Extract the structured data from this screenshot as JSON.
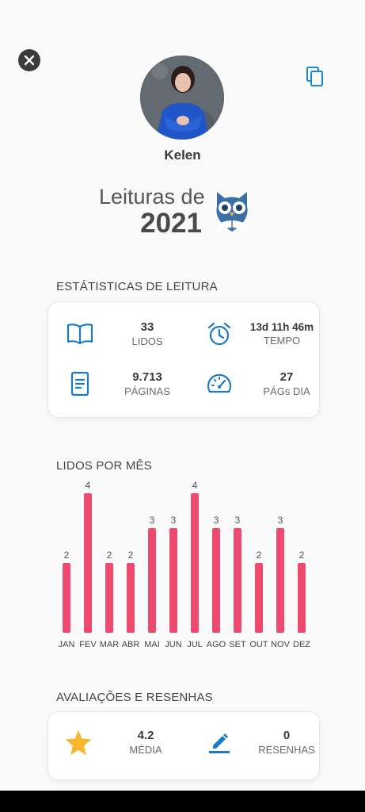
{
  "profile": {
    "name": "Kelen"
  },
  "header": {
    "title": "Leituras de",
    "year": "2021"
  },
  "reading_stats": {
    "title": "ESTÁTISTICAS DE LEITURA",
    "read": {
      "value": "33",
      "label": "LIDOS"
    },
    "time": {
      "value": "13d 11h 46m",
      "label": "TEMPO"
    },
    "pages": {
      "value": "9.713",
      "label": "PÁGINAS"
    },
    "pages_per_day": {
      "value": "27",
      "label": "PÁGs DIA"
    }
  },
  "monthly": {
    "title": "LIDOS POR MÊS"
  },
  "chart_data": {
    "type": "bar",
    "categories": [
      "JAN",
      "FEV",
      "MAR",
      "ABR",
      "MAI",
      "JUN",
      "JUL",
      "AGO",
      "SET",
      "OUT",
      "NOV",
      "DEZ"
    ],
    "values": [
      2,
      4,
      2,
      2,
      3,
      3,
      4,
      3,
      3,
      2,
      3,
      2
    ],
    "title": "LIDOS POR MÊS",
    "color": "#ee4a6e",
    "ylim": [
      0,
      4
    ]
  },
  "reviews": {
    "title": "AVALIAÇÕES E RESENHAS",
    "average": {
      "value": "4.2",
      "label": "MÉDIA"
    },
    "count": {
      "value": "0",
      "label": "RESENHAS"
    }
  },
  "icons": {
    "close": "close-icon",
    "copy": "copy-icon",
    "owl": "owl-icon",
    "book": "book-icon",
    "alarm": "alarm-clock-icon",
    "document": "document-icon",
    "speedometer": "speedometer-icon",
    "star": "star-icon",
    "edit": "pencil-icon"
  },
  "colors": {
    "accent": "#1a7bc4",
    "bar": "#ee4a6e",
    "star": "#f6b72c",
    "owl": "#3a6fa8"
  }
}
